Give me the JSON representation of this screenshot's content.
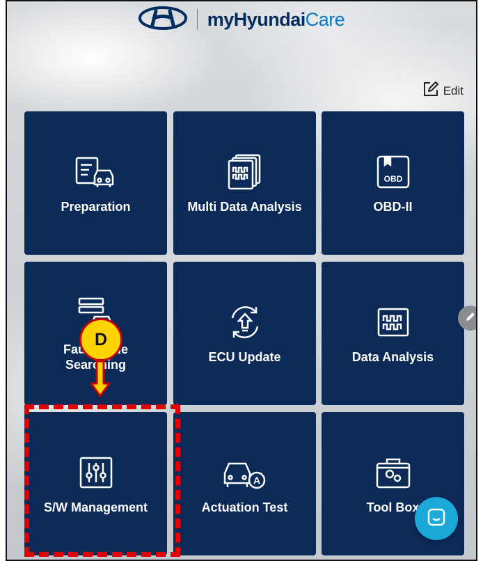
{
  "header": {
    "brand_prefix": "myHyundai",
    "brand_suffix": "Care",
    "logo_icon": "hyundai-logo-icon"
  },
  "edit": {
    "label": "Edit",
    "icon": "edit-square-icon"
  },
  "tiles": [
    {
      "label": "Preparation",
      "icon": "checklist-car-icon"
    },
    {
      "label": "Multi Data Analysis",
      "icon": "stacked-waveform-icon"
    },
    {
      "label": "OBD-II",
      "icon": "obd-connector-icon"
    },
    {
      "label": "Fault Code Searching",
      "icon": "fault-code-car-icon"
    },
    {
      "label": "ECU Update",
      "icon": "refresh-upload-icon"
    },
    {
      "label": "Data Analysis",
      "icon": "waveform-icon"
    },
    {
      "label": "S/W Management",
      "icon": "sliders-icon"
    },
    {
      "label": "Actuation Test",
      "icon": "car-actuation-icon"
    },
    {
      "label": "Tool Box",
      "icon": "toolbox-gear-icon"
    }
  ],
  "annotation": {
    "callout_letter": "D",
    "highlight_target": "S/W Management",
    "highlight_color": "#e00000",
    "callout_color": "#ffd400"
  },
  "floating": {
    "side_button_icon": "pencil-icon",
    "chat_button_icon": "chat-icon"
  },
  "colors": {
    "tile_bg": "#0b2a58",
    "brand": "#002c5f",
    "care": "#0a7ac9",
    "chat": "#1ba9d9"
  }
}
